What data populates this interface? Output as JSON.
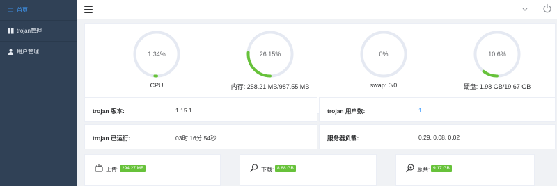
{
  "sidebar": {
    "items": [
      {
        "label": "首页",
        "icon": "home-icon",
        "active": true
      },
      {
        "label": "trojan管理",
        "icon": "grid-icon",
        "active": false
      },
      {
        "label": "用户管理",
        "icon": "user-icon",
        "active": false
      }
    ]
  },
  "header": {
    "menu_icon": "hamburger-icon",
    "dropdown_icon": "chevron-down-icon",
    "logout_icon": "power-icon"
  },
  "gauges": [
    {
      "value_text": "1.34%",
      "percent": 1.34,
      "label": "CPU"
    },
    {
      "value_text": "26.15%",
      "percent": 26.15,
      "label": "内存: 258.21 MB/987.55 MB"
    },
    {
      "value_text": "0%",
      "percent": 0,
      "label": "swap: 0/0"
    },
    {
      "value_text": "10.6%",
      "percent": 10.6,
      "label": "硬盘: 1.98 GB/19.67 GB"
    }
  ],
  "info": {
    "version_label": "trojan 版本:",
    "version_value": "1.15.1",
    "users_label": "trojan 用户数:",
    "users_value": "1",
    "uptime_label": "trojan 已运行:",
    "uptime_value": "03时 16分 54秒",
    "load_label": "服务器负载:",
    "load_value": "0.29, 0.08, 0.02"
  },
  "traffic": [
    {
      "label": "上传:",
      "value": "294.27 MB",
      "icon": "upload-icon"
    },
    {
      "label": "下载:",
      "value": "8.88 GB",
      "icon": "download-icon"
    },
    {
      "label": "总共:",
      "value": "9.17 GB",
      "icon": "total-icon"
    }
  ],
  "colors": {
    "sidebar_bg": "#304156",
    "accent": "#409eff",
    "gauge_track": "#e5e9f2",
    "gauge_fill": "#67c23a",
    "tag_green": "#67c23a"
  }
}
